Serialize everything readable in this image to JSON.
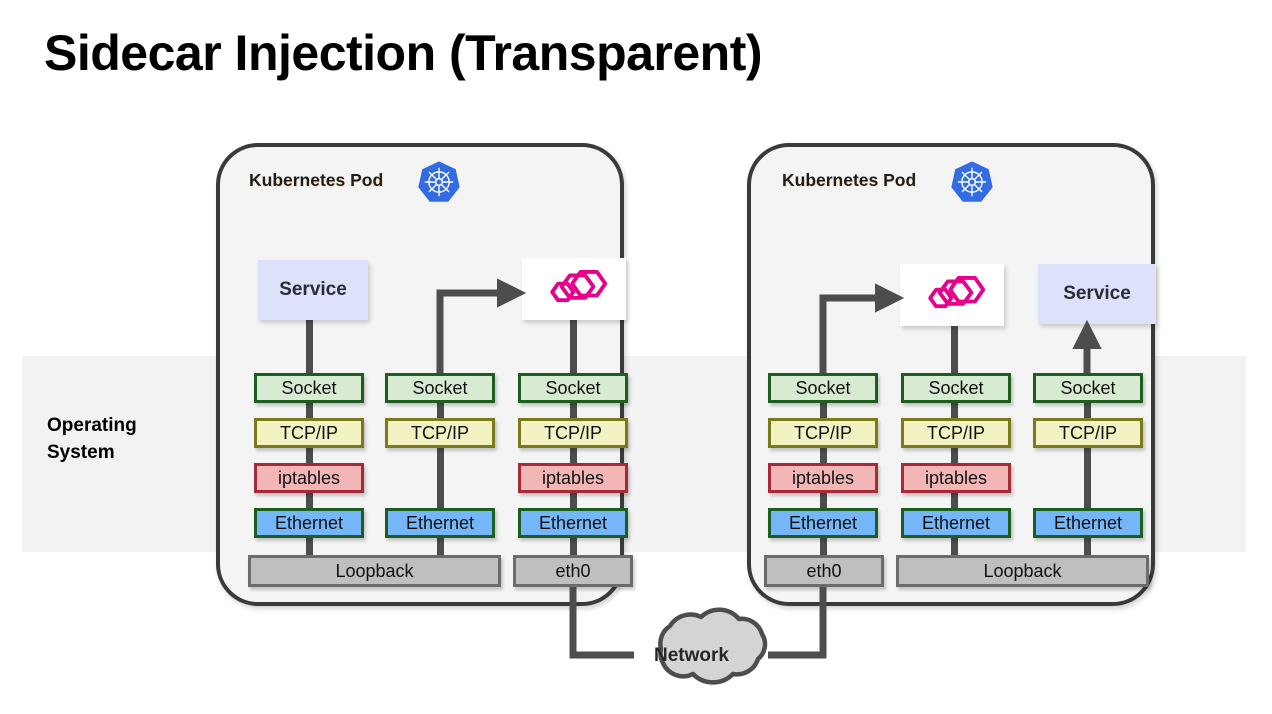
{
  "title": "Sidecar Injection (Transparent)",
  "os": {
    "label": "Operating System"
  },
  "network": {
    "label": "Network"
  },
  "colors": {
    "socket_fill": "#d9ead3",
    "socket_border": "#1b5e20",
    "tcpip_fill": "#f2f2c2",
    "tcpip_border": "#7a7a1b",
    "iptables_fill": "#f2b6b6",
    "iptables_border": "#a62a38",
    "ethernet_fill": "#74b6f7",
    "ethernet_border": "#1b5e20",
    "nic_fill": "#bfbfbf",
    "nic_border": "#6b6b6b",
    "service_fill": "#dde2fa",
    "pod_border": "#3a3a3a",
    "pod_fill": "#f4f4f4",
    "os_band_fill": "#f2f2f2",
    "wire": "#4d4d4d",
    "kubernetes_blue": "#326ce5",
    "envoy_magenta": "#e6008a",
    "cloud_fill": "#d4d4d4"
  },
  "pods": [
    {
      "title": "Kubernetes Pod",
      "icon": "kubernetes-icon",
      "apps": [
        {
          "kind": "service",
          "label": "Service"
        },
        {
          "kind": "envoy",
          "label": "envoy-logo"
        }
      ],
      "columns": [
        {
          "name": "service-column",
          "layers": [
            "Socket",
            "TCP/IP",
            "iptables",
            "Ethernet"
          ],
          "nic": "Loopback"
        },
        {
          "name": "loopback-column",
          "layers": [
            "Socket",
            "TCP/IP",
            "Ethernet"
          ],
          "nic": "Loopback"
        },
        {
          "name": "envoy-column",
          "layers": [
            "Socket",
            "TCP/IP",
            "iptables",
            "Ethernet"
          ],
          "nic": "eth0"
        }
      ]
    },
    {
      "title": "Kubernetes Pod",
      "icon": "kubernetes-icon",
      "apps": [
        {
          "kind": "envoy",
          "label": "envoy-logo"
        },
        {
          "kind": "service",
          "label": "Service"
        }
      ],
      "columns": [
        {
          "name": "eth0-column",
          "layers": [
            "Socket",
            "TCP/IP",
            "iptables",
            "Ethernet"
          ],
          "nic": "eth0"
        },
        {
          "name": "envoy-column",
          "layers": [
            "Socket",
            "TCP/IP",
            "iptables",
            "Ethernet"
          ],
          "nic": "Loopback"
        },
        {
          "name": "service-column",
          "layers": [
            "Socket",
            "TCP/IP",
            "Ethernet"
          ],
          "nic": "Loopback"
        }
      ]
    }
  ],
  "labels": {
    "socket": "Socket",
    "tcpip": "TCP/IP",
    "iptables": "iptables",
    "ethernet": "Ethernet",
    "loopback": "Loopback",
    "eth0": "eth0",
    "service": "Service"
  }
}
